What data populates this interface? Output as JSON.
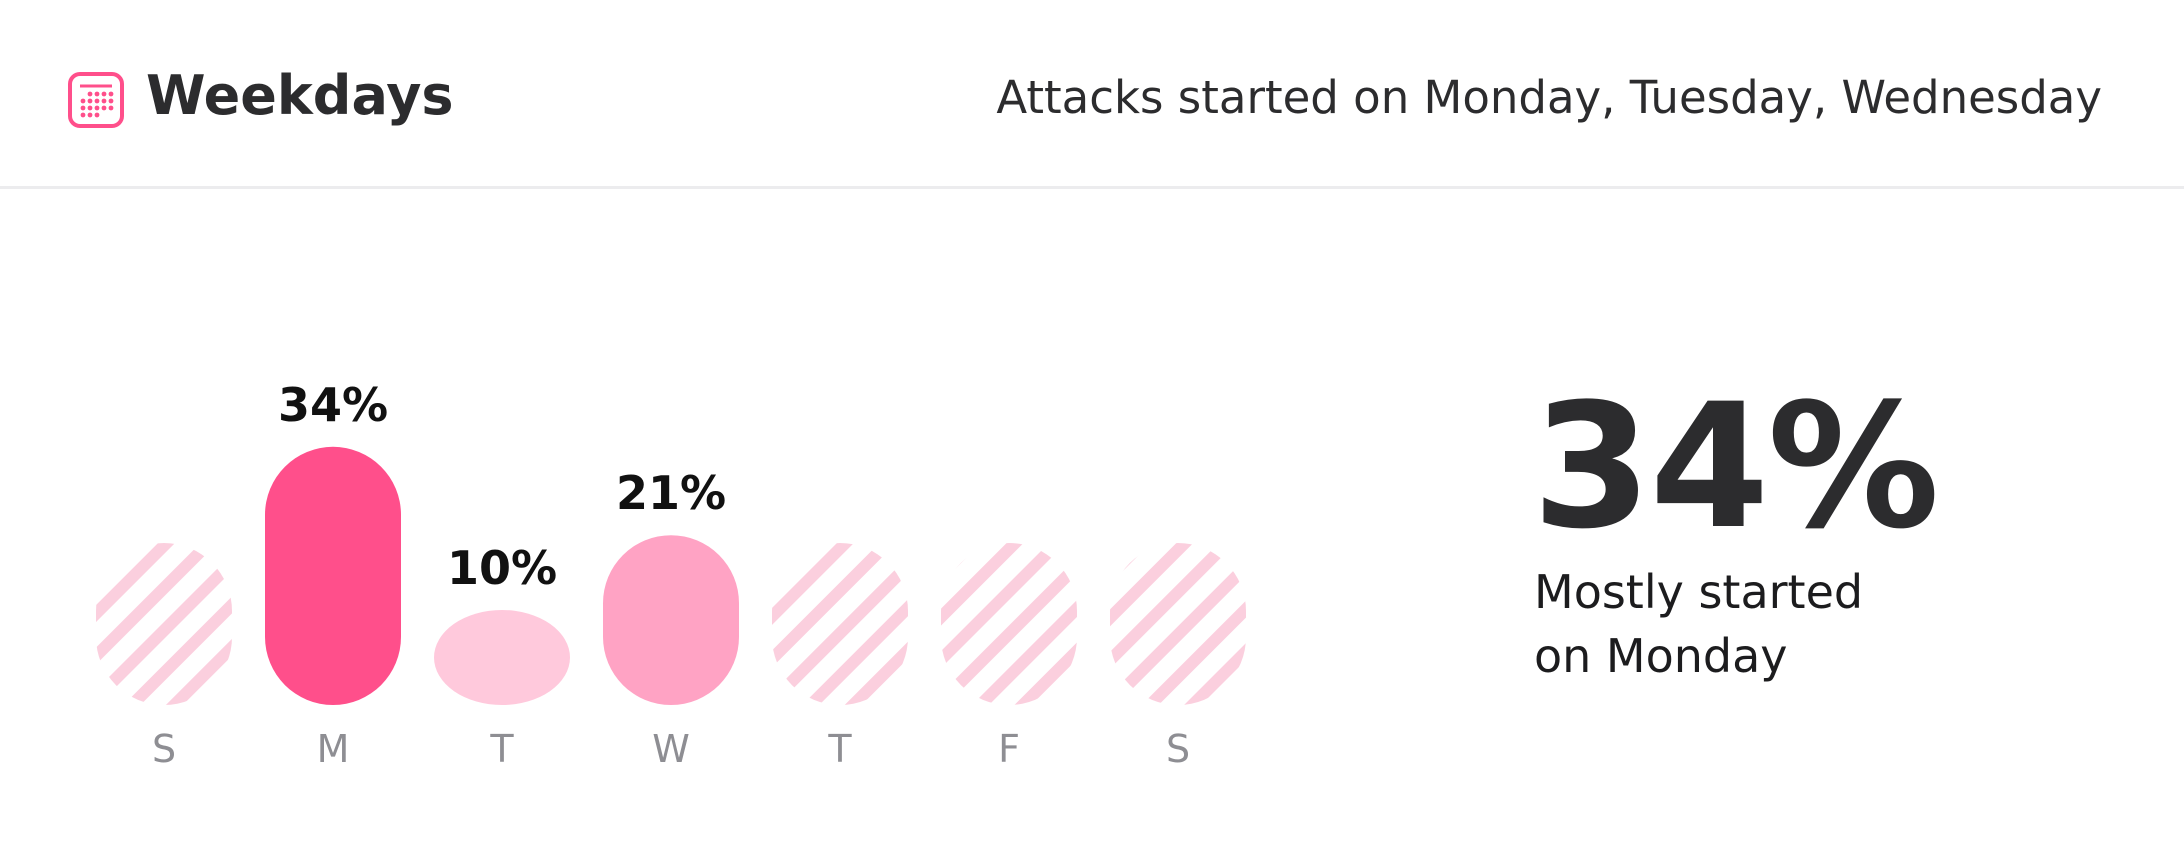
{
  "header": {
    "icon": "calendar-icon",
    "title": "Weekdays",
    "summary": "Attacks started on Monday, Tuesday, Wednesday"
  },
  "colors": {
    "accent": "#ff4f8b",
    "medium": "#ffa3c4",
    "light": "#ffc9dc",
    "hatch": "#fbcfde",
    "day_label": "#8e8e93",
    "text": "#2c2c2e"
  },
  "chart_data": {
    "type": "bar",
    "categories": [
      "S",
      "M",
      "T",
      "W",
      "T",
      "F",
      "S"
    ],
    "values": [
      null,
      34,
      10,
      21,
      null,
      null,
      null
    ],
    "value_labels": [
      "",
      "34%",
      "10%",
      "21%",
      "",
      "",
      ""
    ],
    "title": "",
    "xlabel": "",
    "ylabel": "",
    "unit": "%",
    "empty_style": "hatched-circle"
  },
  "highlight": {
    "value": "34%",
    "caption_line1": "Mostly started",
    "caption_line2": "on Monday"
  }
}
